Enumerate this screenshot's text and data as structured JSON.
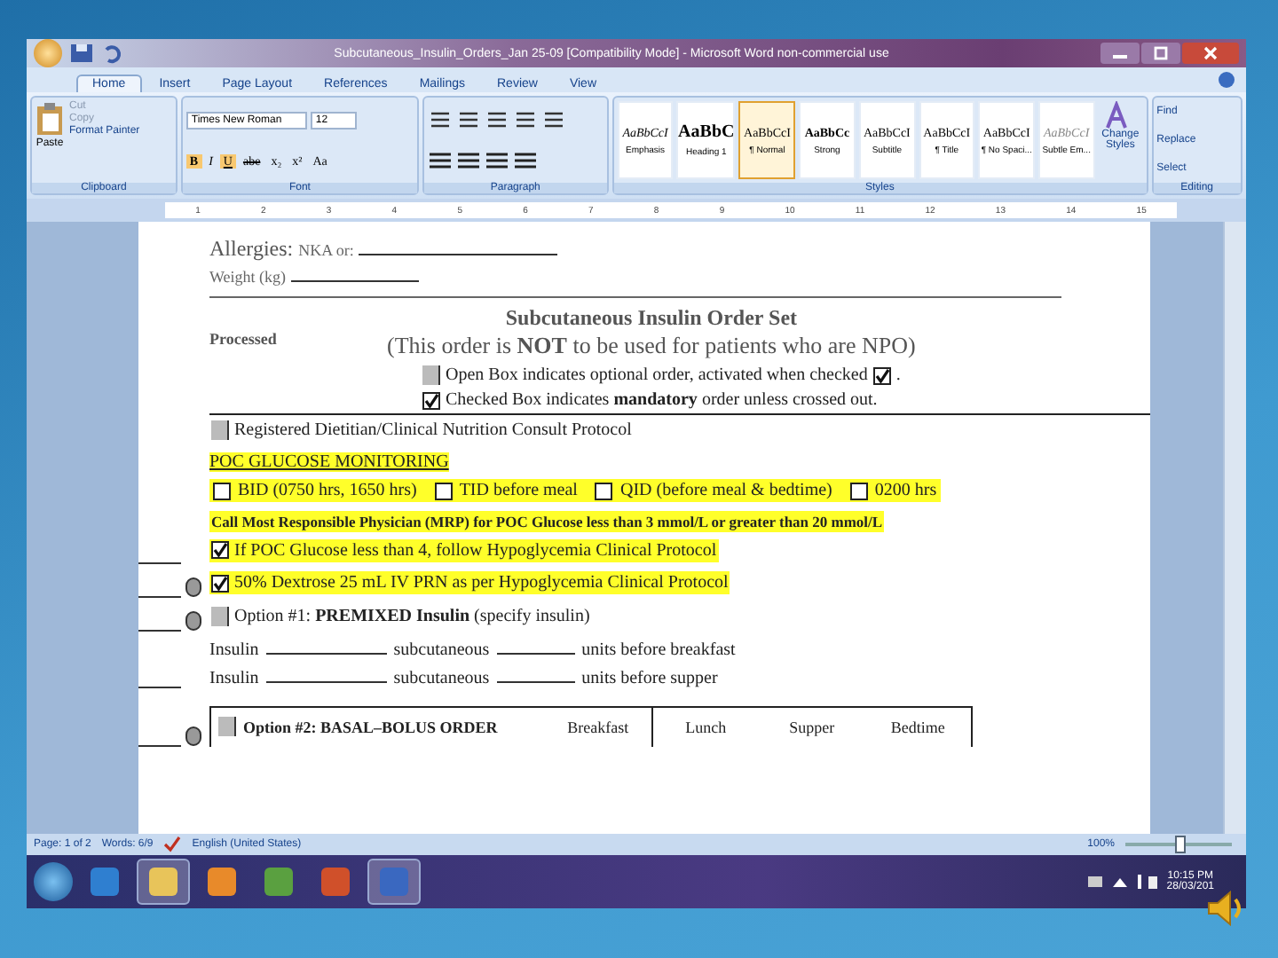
{
  "window": {
    "title": "Subcutaneous_Insulin_Orders_Jan 25-09 [Compatibility Mode] - Microsoft Word non-commercial use"
  },
  "tabs": [
    {
      "label": "Home",
      "selected": true
    },
    {
      "label": "Insert",
      "selected": false
    },
    {
      "label": "Page Layout",
      "selected": false
    },
    {
      "label": "References",
      "selected": false
    },
    {
      "label": "Mailings",
      "selected": false
    },
    {
      "label": "Review",
      "selected": false
    },
    {
      "label": "View",
      "selected": false
    }
  ],
  "clipboard": {
    "paste": "Paste",
    "cut": "Cut",
    "copy": "Copy",
    "format_painter": "Format Painter",
    "group": "Clipboard"
  },
  "font": {
    "family": "Times New Roman",
    "size": "12",
    "buttons": [
      "B",
      "I",
      "U",
      "abe",
      "x₂",
      "x²",
      "Aa"
    ],
    "group": "Font"
  },
  "paragraph": {
    "group": "Paragraph"
  },
  "styles": {
    "group": "Styles",
    "change": "Change Styles",
    "items": [
      {
        "preview": "AaBbCcI",
        "label": "Emphasis",
        "selected": false
      },
      {
        "preview": "AaBbC",
        "label": "Heading 1",
        "selected": false
      },
      {
        "preview": "AaBbCcI",
        "label": "¶ Normal",
        "selected": true
      },
      {
        "preview": "AaBbCc",
        "label": "Strong",
        "selected": false
      },
      {
        "preview": "AaBbCcI",
        "label": "Subtitle",
        "selected": false
      },
      {
        "preview": "AaBbCcI",
        "label": "¶ Title",
        "selected": false
      },
      {
        "preview": "AaBbCcI",
        "label": "¶ No Spaci...",
        "selected": false
      },
      {
        "preview": "AaBbCcI",
        "label": "Subtle Em...",
        "selected": false
      }
    ]
  },
  "editing": {
    "group": "Editing",
    "items": [
      "Find",
      "Replace",
      "Select"
    ]
  },
  "ruler": [
    "1",
    "2",
    "3",
    "4",
    "5",
    "6",
    "7",
    "8",
    "9",
    "10",
    "11",
    "12",
    "13",
    "14",
    "15"
  ],
  "document": {
    "allergies": "Allergies:",
    "allergies_hint": "NKA or:",
    "weight": "Weight (kg)",
    "processed": "Processed",
    "title": "Subcutaneous Insulin Order Set",
    "subtitle": "(This order is **NOT** to be used for patients who are NPO)",
    "legend": [
      {
        "kind": "field",
        "text": "Open Box indicates optional order, activated when checked",
        "tail": ".",
        "tail_checked": true
      },
      {
        "kind": "check",
        "checked": true,
        "text": "Checked Box indicates **mandatory** order unless crossed out."
      }
    ],
    "lines": [
      {
        "kind": "field_order",
        "text": "Registered Dietitian/Clinical Nutrition Consult Protocol",
        "highlighted": false,
        "signature": false,
        "pill": false
      },
      {
        "kind": "heading",
        "text": "POC GLUCOSE MONITORING",
        "highlighted": true
      },
      {
        "kind": "choices",
        "highlighted": true,
        "options": [
          {
            "text": "BID (0750 hrs, 1650 hrs)",
            "checked": false
          },
          {
            "text": "TID before meal",
            "checked": false
          },
          {
            "text": "QID (before meal & bedtime)",
            "checked": false
          },
          {
            "text": "0200 hrs",
            "checked": false
          }
        ]
      },
      {
        "kind": "note",
        "text": "Call Most Responsible Physician (MRP) for POC Glucose less than 3 mmol/L or greater than 20 mmol/L",
        "highlighted": true
      },
      {
        "kind": "check_order",
        "checked": true,
        "text": "If POC Glucose less than 4, follow Hypoglycemia Clinical Protocol",
        "highlighted": true,
        "signature": true,
        "pill": false
      },
      {
        "kind": "check_order",
        "checked": true,
        "text": "50% Dextrose 25 mL IV PRN as per Hypoglycemia Clinical Protocol",
        "highlighted": true,
        "signature": true,
        "pill": true
      },
      {
        "kind": "field_order",
        "text": "Option #1:  **PREMIXED Insulin**  (specify insulin)",
        "highlighted": false,
        "signature": true,
        "pill": true
      },
      {
        "kind": "fill",
        "parts": [
          "Insulin",
          "subcutaneous",
          "units before breakfast"
        ],
        "signature": false,
        "pill": false
      },
      {
        "kind": "fill",
        "parts": [
          "Insulin",
          "subcutaneous",
          "units before supper"
        ],
        "signature": true,
        "pill": false
      },
      {
        "kind": "table",
        "label": "Option #2: BASAL–BOLUS ORDER",
        "columns": [
          "Breakfast",
          "Lunch",
          "Supper",
          "Bedtime"
        ],
        "signature": true,
        "pill": true
      }
    ]
  },
  "status_bar": {
    "page": "Page: 1 of 2",
    "words": "Words: 6/9",
    "language": "English (United States)",
    "zoom": "100%",
    "level": 0.5
  },
  "taskbar": {
    "time": "10:15 PM",
    "date": "28/03/201",
    "apps": [
      {
        "kind": "ie",
        "selected": false
      },
      {
        "kind": "folder",
        "selected": true
      },
      {
        "kind": "media",
        "selected": false
      },
      {
        "kind": "people",
        "selected": false
      },
      {
        "kind": "powerpoint",
        "selected": false
      },
      {
        "kind": "word",
        "selected": true
      }
    ]
  }
}
